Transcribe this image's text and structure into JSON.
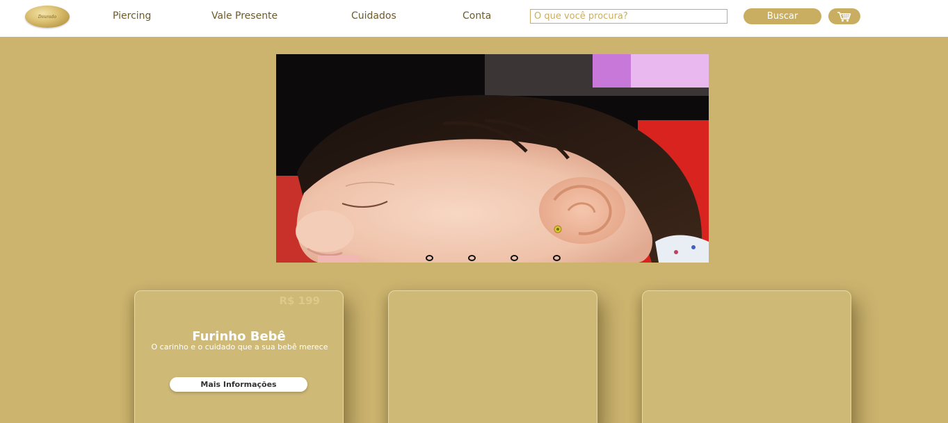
{
  "header": {
    "logo_text": "Dourado",
    "nav": [
      {
        "label": "Piercing"
      },
      {
        "label": "Vale Presente"
      },
      {
        "label": "Cuidados"
      },
      {
        "label": "Conta"
      }
    ],
    "search": {
      "placeholder": "O que você procura?"
    },
    "search_button_label": "Buscar",
    "cart_icon": "shopping-cart-icon"
  },
  "carousel": {
    "slide_count": 4,
    "active_slide": 1
  },
  "cards": [
    {
      "price": "R$ 199",
      "title": "Furinho Bebê",
      "description": "O carinho e o cuidado que a sua bebê merece",
      "button_label": "Mais Informações"
    },
    {},
    {}
  ],
  "colors": {
    "background": "#CCB46F",
    "accent": "#C9AE62",
    "card": "#CFB977",
    "header": "#FFFFFF"
  }
}
